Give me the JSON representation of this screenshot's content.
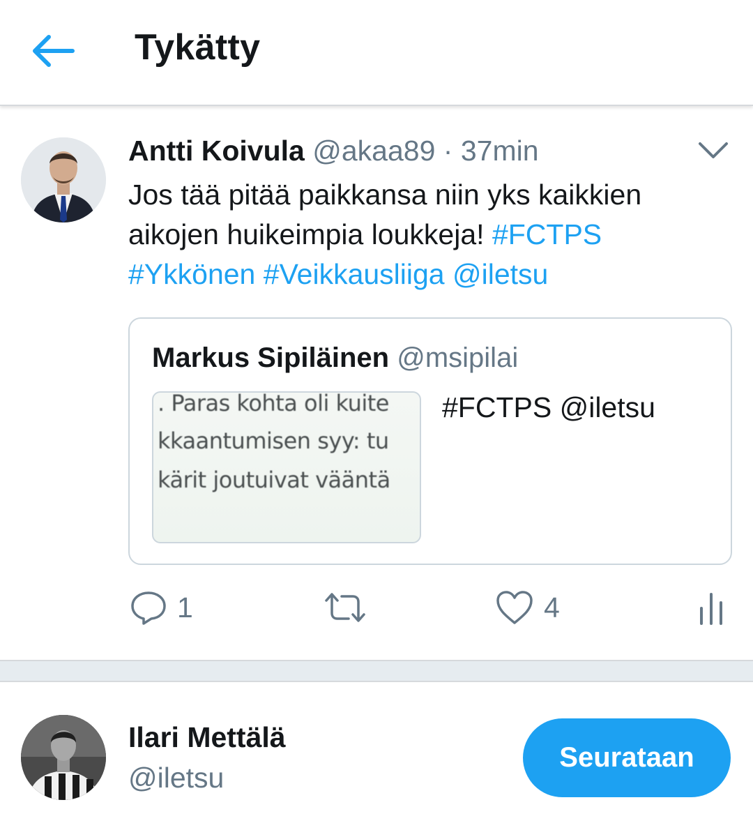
{
  "header": {
    "back_icon": "arrow-left-icon",
    "title": "Tykätty",
    "accent_color": "#1da1f2"
  },
  "tweet": {
    "author_name": "Antti Koivula",
    "author_handle": "@akaa89",
    "separator": "·",
    "time": "37min",
    "caret_icon": "chevron-down-icon",
    "text_plain": "Jos tää pitää paikkansa niin yks kaikkien aikojen huikeimpia loukkeja!",
    "hashtag_1": "#FCTPS",
    "hashtag_2": "#Ykkönen",
    "hashtag_3": "#Veikkausliiga",
    "mention": "@iletsu",
    "quote": {
      "author_name": "Markus Sipiläinen",
      "author_handle": "@msipilai",
      "image_lines": [
        ". Paras kohta oli kuite",
        "kkaantumisen syy: tu",
        "kärit joutuivat vääntä"
      ],
      "text": "#FCTPS @iletsu"
    },
    "actions": {
      "reply_icon": "reply-icon",
      "reply_count": "1",
      "retweet_icon": "retweet-icon",
      "like_icon": "heart-icon",
      "like_count": "4",
      "analytics_icon": "analytics-icon"
    }
  },
  "user_card": {
    "name": "Ilari Mettälä",
    "handle": "@iletsu",
    "follow_label": "Seurataan"
  }
}
